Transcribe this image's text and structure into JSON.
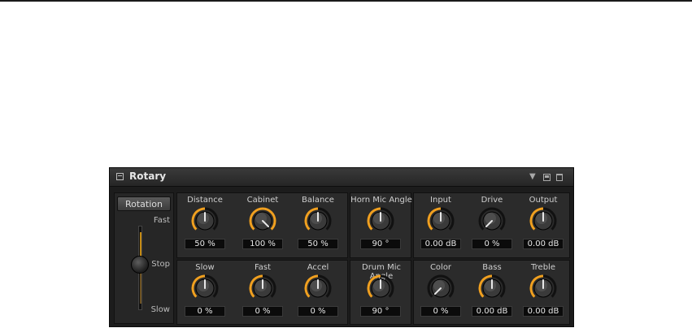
{
  "plugin": {
    "title": "Rotary",
    "icons": {
      "menu": "menu-icon",
      "dropdown": "dropdown-icon",
      "save": "save-icon",
      "delete": "trash-icon"
    }
  },
  "rotation": {
    "button_label": "Rotation",
    "labels": {
      "fast": "Fast",
      "stop": "Stop",
      "slow": "Slow"
    }
  },
  "knobs": {
    "distance": {
      "label": "Distance",
      "value": "50 %",
      "level": 0.5
    },
    "cabinet": {
      "label": "Cabinet",
      "value": "100 %",
      "level": 1.0
    },
    "balance": {
      "label": "Balance",
      "value": "50 %",
      "level": 0.5
    },
    "slow": {
      "label": "Slow",
      "value": "0 %",
      "level": 0.5
    },
    "fast": {
      "label": "Fast",
      "value": "0 %",
      "level": 0.5
    },
    "accel": {
      "label": "Accel",
      "value": "0 %",
      "level": 0.5
    },
    "horn_mic_angle": {
      "label": "Horn Mic Angle",
      "value": "90 °",
      "level": 0.5
    },
    "drum_mic_angle": {
      "label": "Drum Mic Angle",
      "value": "90 °",
      "level": 0.5
    },
    "input": {
      "label": "Input",
      "value": "0.00 dB",
      "level": 0.5
    },
    "drive": {
      "label": "Drive",
      "value": "0 %",
      "level": 0.0
    },
    "output": {
      "label": "Output",
      "value": "0.00 dB",
      "level": 0.5
    },
    "color": {
      "label": "Color",
      "value": "0 %",
      "level": 0.0
    },
    "bass": {
      "label": "Bass",
      "value": "0.00 dB",
      "level": 0.5
    },
    "treble": {
      "label": "Treble",
      "value": "0.00 dB",
      "level": 0.5
    }
  },
  "colors": {
    "accent": "#f0a020",
    "panel": "#2b2b2b",
    "background": "#1c1c1c"
  }
}
